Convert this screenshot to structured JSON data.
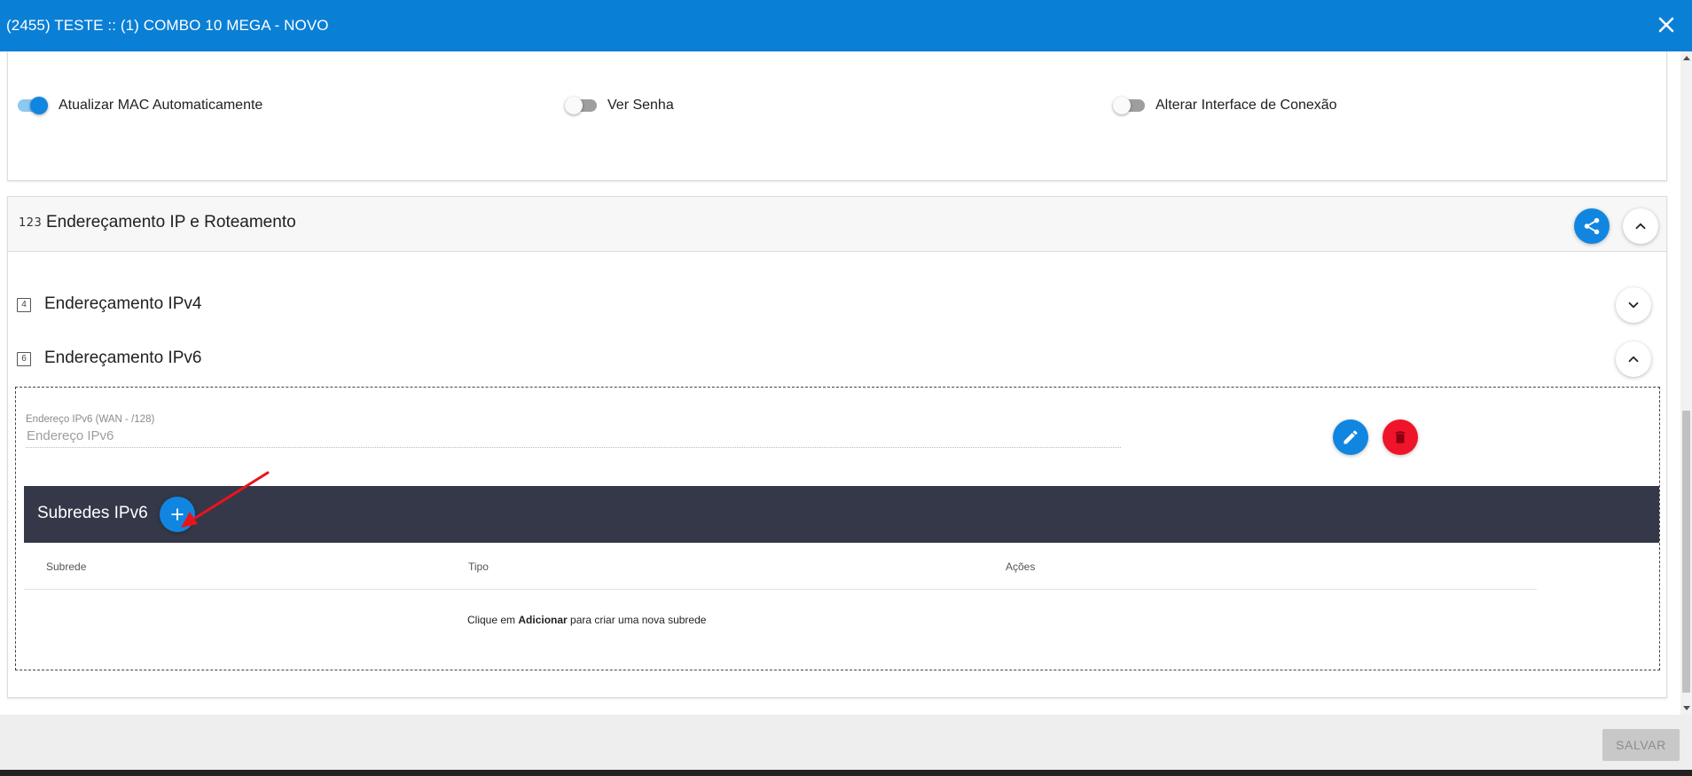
{
  "window": {
    "title": "(2455) TESTE :: (1) COMBO 10 MEGA - NOVO",
    "close_icon": "close-icon"
  },
  "toggles": [
    {
      "label": "Atualizar MAC Automaticamente",
      "on": true
    },
    {
      "label": "Ver Senha",
      "on": false
    },
    {
      "label": "Alterar Interface de Conexão",
      "on": false
    }
  ],
  "section": {
    "icon_text": "123",
    "title": "Endereçamento IP e Roteamento",
    "share_icon": "share-icon",
    "collapse_icon": "chevron-up-icon"
  },
  "ipv4": {
    "icon_text": "4",
    "title": "Endereçamento IPv4",
    "toggle_icon": "chevron-down-icon"
  },
  "ipv6": {
    "icon_text": "6",
    "title": "Endereçamento IPv6",
    "toggle_icon": "chevron-up-icon",
    "field_label": "Endereço IPv6 (WAN - /128)",
    "field_placeholder": "Endereço IPv6",
    "edit_icon": "pencil-icon",
    "delete_icon": "trash-icon"
  },
  "subnets": {
    "title": "Subredes IPv6",
    "add_icon": "plus-icon",
    "columns": [
      "Subrede",
      "Tipo",
      "Ações"
    ],
    "empty_prefix": "Clique em ",
    "empty_bold": "Adicionar",
    "empty_suffix": " para criar uma nova subrede"
  },
  "footer": {
    "save_label": "SALVAR"
  },
  "colors": {
    "primary": "#0a7fd6",
    "danger": "#f0142a",
    "dark_bar": "#353849",
    "annotation_arrow": "#e8141b"
  }
}
